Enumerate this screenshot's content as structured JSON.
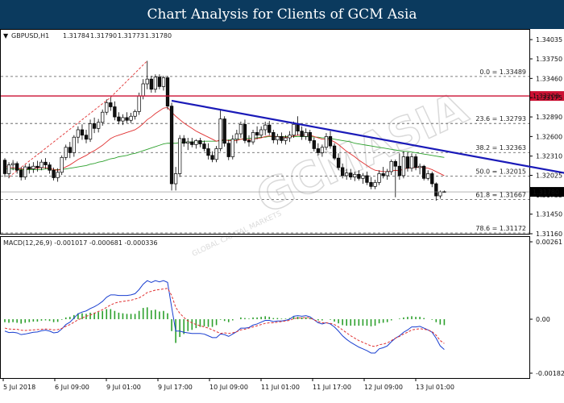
{
  "page": {
    "title": "Chart Analysis for Clients of GCM Asia"
  },
  "chart_data": {
    "type": "candlestick",
    "symbol_info": {
      "symbol": "GBPUSD,H1",
      "open": "1.31784",
      "high": "1.31790",
      "low": "1.31773",
      "close": "1.31780"
    },
    "y_axis": {
      "range": [
        1.3116,
        1.3418
      ],
      "ticks": [
        "1.34035",
        "1.33750",
        "1.33460",
        "1.33175",
        "1.32890",
        "1.32600",
        "1.32310",
        "1.32025",
        "1.31735",
        "1.31450",
        "1.31160"
      ]
    },
    "current_price": "1.31780",
    "resistance_price": "1.33200",
    "fib_levels": [
      {
        "label": "0.0 = 1.33489",
        "value": 1.33489
      },
      {
        "label": "23.6 = 1.32793",
        "value": 1.32793
      },
      {
        "label": "38.2 = 1.32363",
        "value": 1.32363
      },
      {
        "label": "50.0 = 1.32015",
        "value": 1.32015
      },
      {
        "label": "61.8 = 1.31667",
        "value": 1.31667
      },
      {
        "label": "78.6 = 1.31172",
        "value": 1.31172
      }
    ],
    "x_labels": [
      "5 Jul 2018",
      "6 Jul 09:00",
      "9 Jul 01:00",
      "9 Jul 17:00",
      "10 Jul 09:00",
      "11 Jul 01:00",
      "11 Jul 17:00",
      "12 Jul 09:00",
      "13 Jul 01:00"
    ],
    "candles": [
      [
        1.3225,
        1.3228,
        1.32,
        1.3205
      ],
      [
        1.3205,
        1.3222,
        1.3198,
        1.3218
      ],
      [
        1.3218,
        1.3225,
        1.321,
        1.322
      ],
      [
        1.322,
        1.3223,
        1.3205,
        1.321
      ],
      [
        1.321,
        1.3215,
        1.3195,
        1.32
      ],
      [
        1.32,
        1.3218,
        1.3196,
        1.3215
      ],
      [
        1.3215,
        1.322,
        1.3205,
        1.3212
      ],
      [
        1.3212,
        1.3222,
        1.3206,
        1.3216
      ],
      [
        1.3216,
        1.3224,
        1.3208,
        1.3214
      ],
      [
        1.3214,
        1.3226,
        1.321,
        1.3222
      ],
      [
        1.3222,
        1.3228,
        1.3212,
        1.3218
      ],
      [
        1.3218,
        1.3222,
        1.3205,
        1.321
      ],
      [
        1.321,
        1.3214,
        1.3195,
        1.3199
      ],
      [
        1.3199,
        1.3213,
        1.3193,
        1.3207
      ],
      [
        1.3207,
        1.3232,
        1.3203,
        1.3229
      ],
      [
        1.3229,
        1.3248,
        1.3225,
        1.3244
      ],
      [
        1.3244,
        1.3252,
        1.3228,
        1.3236
      ],
      [
        1.3236,
        1.3262,
        1.323,
        1.3259
      ],
      [
        1.3259,
        1.3275,
        1.325,
        1.327
      ],
      [
        1.327,
        1.3278,
        1.3255,
        1.3262
      ],
      [
        1.3262,
        1.327,
        1.325,
        1.3256
      ],
      [
        1.3256,
        1.3285,
        1.3252,
        1.3279
      ],
      [
        1.3279,
        1.3288,
        1.3265,
        1.3272
      ],
      [
        1.3272,
        1.3286,
        1.3266,
        1.3281
      ],
      [
        1.3281,
        1.33,
        1.3276,
        1.3296
      ],
      [
        1.3296,
        1.3315,
        1.3292,
        1.331
      ],
      [
        1.331,
        1.3318,
        1.3298,
        1.3304
      ],
      [
        1.3304,
        1.3312,
        1.3284,
        1.3289
      ],
      [
        1.3289,
        1.3296,
        1.3278,
        1.3283
      ],
      [
        1.3283,
        1.3293,
        1.3277,
        1.3288
      ],
      [
        1.3288,
        1.3296,
        1.328,
        1.3284
      ],
      [
        1.3284,
        1.3295,
        1.328,
        1.329
      ],
      [
        1.329,
        1.33,
        1.3285,
        1.3297
      ],
      [
        1.3297,
        1.3325,
        1.3292,
        1.332
      ],
      [
        1.332,
        1.3345,
        1.3315,
        1.3338
      ],
      [
        1.3338,
        1.3372,
        1.333,
        1.3345
      ],
      [
        1.3345,
        1.335,
        1.3325,
        1.333
      ],
      [
        1.333,
        1.3352,
        1.3325,
        1.3348
      ],
      [
        1.3348,
        1.3352,
        1.333,
        1.3334
      ],
      [
        1.3334,
        1.335,
        1.3328,
        1.3347
      ],
      [
        1.3347,
        1.335,
        1.33,
        1.3305
      ],
      [
        1.3305,
        1.331,
        1.318,
        1.319
      ],
      [
        1.319,
        1.3215,
        1.318,
        1.3205
      ],
      [
        1.3205,
        1.3262,
        1.32,
        1.3257
      ],
      [
        1.3257,
        1.3262,
        1.3245,
        1.325
      ],
      [
        1.325,
        1.3258,
        1.324,
        1.3252
      ],
      [
        1.3252,
        1.3258,
        1.3244,
        1.3248
      ],
      [
        1.3248,
        1.3256,
        1.3242,
        1.3254
      ],
      [
        1.3254,
        1.3258,
        1.3244,
        1.3249
      ],
      [
        1.3249,
        1.3254,
        1.3238,
        1.3242
      ],
      [
        1.3242,
        1.325,
        1.3226,
        1.3232
      ],
      [
        1.3232,
        1.3238,
        1.3222,
        1.3226
      ],
      [
        1.3226,
        1.3246,
        1.3222,
        1.3242
      ],
      [
        1.3242,
        1.3299,
        1.3238,
        1.3286
      ],
      [
        1.3286,
        1.329,
        1.3245,
        1.325
      ],
      [
        1.325,
        1.3255,
        1.3225,
        1.323
      ],
      [
        1.323,
        1.3262,
        1.3226,
        1.3256
      ],
      [
        1.3256,
        1.327,
        1.325,
        1.3264
      ],
      [
        1.3264,
        1.3282,
        1.3258,
        1.3278
      ],
      [
        1.3278,
        1.3285,
        1.325,
        1.3254
      ],
      [
        1.3254,
        1.3262,
        1.3245,
        1.3252
      ],
      [
        1.3252,
        1.327,
        1.3248,
        1.3266
      ],
      [
        1.3266,
        1.3275,
        1.3256,
        1.3262
      ],
      [
        1.3262,
        1.3275,
        1.3258,
        1.327
      ],
      [
        1.327,
        1.3282,
        1.3262,
        1.3277
      ],
      [
        1.3277,
        1.3283,
        1.3262,
        1.3266
      ],
      [
        1.3266,
        1.327,
        1.325,
        1.3255
      ],
      [
        1.3255,
        1.3264,
        1.3248,
        1.326
      ],
      [
        1.326,
        1.3266,
        1.325,
        1.3254
      ],
      [
        1.3254,
        1.3262,
        1.3248,
        1.3258
      ],
      [
        1.3258,
        1.3268,
        1.3252,
        1.3262
      ],
      [
        1.3262,
        1.3282,
        1.3258,
        1.3278
      ],
      [
        1.3278,
        1.329,
        1.3262,
        1.3268
      ],
      [
        1.3268,
        1.3275,
        1.3255,
        1.326
      ],
      [
        1.326,
        1.3272,
        1.3255,
        1.3266
      ],
      [
        1.3266,
        1.327,
        1.325,
        1.3254
      ],
      [
        1.3254,
        1.3258,
        1.3238,
        1.3242
      ],
      [
        1.3242,
        1.325,
        1.3232,
        1.3236
      ],
      [
        1.3236,
        1.3248,
        1.323,
        1.3244
      ],
      [
        1.3244,
        1.3265,
        1.324,
        1.326
      ],
      [
        1.326,
        1.3268,
        1.3242,
        1.3246
      ],
      [
        1.3246,
        1.325,
        1.3225,
        1.3228
      ],
      [
        1.3228,
        1.3235,
        1.321,
        1.3214
      ],
      [
        1.3214,
        1.322,
        1.3198,
        1.3202
      ],
      [
        1.3202,
        1.3212,
        1.3196,
        1.3206
      ],
      [
        1.3206,
        1.3212,
        1.3196,
        1.32
      ],
      [
        1.32,
        1.3208,
        1.3194,
        1.3204
      ],
      [
        1.3204,
        1.321,
        1.3195,
        1.3198
      ],
      [
        1.3198,
        1.3206,
        1.319,
        1.3202
      ],
      [
        1.3202,
        1.3208,
        1.3188,
        1.3192
      ],
      [
        1.3192,
        1.32,
        1.3182,
        1.3186
      ],
      [
        1.3186,
        1.3196,
        1.3182,
        1.3192
      ],
      [
        1.3192,
        1.321,
        1.3188,
        1.3205
      ],
      [
        1.3205,
        1.3215,
        1.3198,
        1.3202
      ],
      [
        1.3202,
        1.3212,
        1.3196,
        1.3208
      ],
      [
        1.3208,
        1.3226,
        1.3203,
        1.3223
      ],
      [
        1.3223,
        1.3226,
        1.317,
        1.3216
      ],
      [
        1.3216,
        1.3235,
        1.3196,
        1.3202
      ],
      [
        1.3202,
        1.3238,
        1.3198,
        1.323
      ],
      [
        1.323,
        1.3236,
        1.3208,
        1.3213
      ],
      [
        1.3213,
        1.3235,
        1.3208,
        1.323
      ],
      [
        1.323,
        1.3234,
        1.321,
        1.3214
      ],
      [
        1.3214,
        1.322,
        1.3204,
        1.3216
      ],
      [
        1.3216,
        1.3218,
        1.3195,
        1.3198
      ],
      [
        1.3198,
        1.321,
        1.3195,
        1.3205
      ],
      [
        1.3205,
        1.3208,
        1.3185,
        1.319
      ],
      [
        1.319,
        1.3192,
        1.3165,
        1.3172
      ],
      [
        1.3172,
        1.318,
        1.3168,
        1.3178
      ],
      [
        1.31784,
        1.318,
        1.31773,
        1.3178
      ]
    ],
    "ma_red": [
      1.3216,
      1.3214,
      1.3214,
      1.3213,
      1.3212,
      1.3212,
      1.3212,
      1.3213,
      1.3213,
      1.3214,
      1.3214,
      1.3213,
      1.3211,
      1.321,
      1.3212,
      1.3215,
      1.3218,
      1.3222,
      1.3226,
      1.3229,
      1.3232,
      1.3236,
      1.3239,
      1.3243,
      1.3247,
      1.3252,
      1.3257,
      1.326,
      1.3262,
      1.3264,
      1.3266,
      1.3268,
      1.327,
      1.3274,
      1.3279,
      1.3285,
      1.3289,
      1.3294,
      1.3298,
      1.3302,
      1.3303,
      1.3296,
      1.329,
      1.3285,
      1.328,
      1.3276,
      1.3272,
      1.3268,
      1.3265,
      1.3262,
      1.3259,
      1.3256,
      1.3253,
      1.3255,
      1.3255,
      1.3254,
      1.3254,
      1.3254,
      1.3256,
      1.3256,
      1.3255,
      1.3256,
      1.3257,
      1.3258,
      1.326,
      1.3261,
      1.326,
      1.326,
      1.3259,
      1.3259,
      1.3259,
      1.3261,
      1.3262,
      1.3262,
      1.3262,
      1.3262,
      1.326,
      1.3258,
      1.3256,
      1.3256,
      1.3255,
      1.3252,
      1.3248,
      1.3243,
      1.3238,
      1.3234,
      1.323,
      1.3225,
      1.3221,
      1.3217,
      1.3213,
      1.321,
      1.3209,
      1.3208,
      1.3208,
      1.3209,
      1.321,
      1.3209,
      1.3212,
      1.3213,
      1.3214,
      1.3214,
      1.3215,
      1.3214,
      1.3213,
      1.3211,
      1.3208,
      1.3205,
      1.3202
    ],
    "ma_green": [
      1.3212,
      1.3212,
      1.3212,
      1.3211,
      1.3211,
      1.3211,
      1.3211,
      1.3211,
      1.3211,
      1.3211,
      1.3212,
      1.3212,
      1.3211,
      1.3211,
      1.3211,
      1.3212,
      1.3213,
      1.3214,
      1.3215,
      1.3216,
      1.3217,
      1.3219,
      1.322,
      1.3222,
      1.3223,
      1.3225,
      1.3227,
      1.3228,
      1.323,
      1.3231,
      1.3232,
      1.3234,
      1.3235,
      1.3237,
      1.3239,
      1.3241,
      1.3243,
      1.3245,
      1.3247,
      1.3249,
      1.325,
      1.325,
      1.325,
      1.3251,
      1.3251,
      1.3252,
      1.3252,
      1.3252,
      1.3252,
      1.3253,
      1.3253,
      1.3253,
      1.3253,
      1.3254,
      1.3254,
      1.3255,
      1.3255,
      1.3256,
      1.3256,
      1.3257,
      1.3257,
      1.3258,
      1.3258,
      1.3259,
      1.3259,
      1.326,
      1.326,
      1.326,
      1.326,
      1.326,
      1.326,
      1.326,
      1.326,
      1.326,
      1.326,
      1.326,
      1.3259,
      1.3259,
      1.3258,
      1.3258,
      1.3257,
      1.3256,
      1.3255,
      1.3254,
      1.3253,
      1.3252,
      1.325,
      1.3249,
      1.3248,
      1.3247,
      1.3246,
      1.3245,
      1.3244,
      1.3243,
      1.3242,
      1.3241,
      1.324,
      1.3239,
      1.3238,
      1.3238,
      1.3237,
      1.3236,
      1.3235,
      1.3234,
      1.3233,
      1.3232,
      1.3231,
      1.323,
      1.3229
    ],
    "trendline": {
      "from": {
        "index": 41,
        "value": 1.3313
      },
      "to": {
        "index": 142,
        "value": 1.3201
      }
    },
    "macd": {
      "label": "MACD(12,26,9) -0.001017 -0.000681 -0.000336",
      "range": [
        -0.00182,
        0.00261
      ],
      "ticks": [
        "0.00261",
        "0.00",
        "-0.00182"
      ],
      "histogram": [
        -0.0001,
        -0.00012,
        -0.0001,
        -0.00012,
        -0.00015,
        -0.00012,
        -0.0001,
        -8e-05,
        -8e-05,
        -5e-05,
        -4e-05,
        -6e-05,
        -0.0001,
        -9e-05,
        -2e-05,
        6e-05,
        8e-05,
        0.00014,
        0.0002,
        0.0002,
        0.00018,
        0.00022,
        0.00022,
        0.00024,
        0.00028,
        0.00034,
        0.00034,
        0.00028,
        0.00022,
        0.0002,
        0.00018,
        0.00018,
        0.00018,
        0.00028,
        0.00038,
        0.0004,
        0.0003,
        0.00032,
        0.00026,
        0.00028,
        0.0002,
        -0.0004,
        -0.0008,
        -0.0006,
        -0.0005,
        -0.0004,
        -0.00036,
        -0.0003,
        -0.00026,
        -0.00024,
        -0.00026,
        -0.00026,
        -0.0002,
        -2e-05,
        -6e-05,
        -0.0001,
        -4e-05,
        0.0,
        6e-05,
        4e-05,
        2e-05,
        6e-05,
        6e-05,
        8e-05,
        0.0001,
        8e-05,
        4e-05,
        4e-05,
        2e-05,
        2e-05,
        4e-05,
        8e-05,
        8e-05,
        6e-05,
        6e-05,
        4e-05,
        0.0,
        -4e-05,
        -4e-05,
        0.0,
        -2e-05,
        -8e-05,
        -0.00014,
        -0.0002,
        -0.00022,
        -0.00022,
        -0.00022,
        -0.00022,
        -0.00022,
        -0.00022,
        -0.00024,
        -0.00022,
        -0.00014,
        -0.00012,
        -0.0001,
        -4e-05,
        0.0,
        2e-05,
        6e-05,
        8e-05,
        0.0001,
        8e-05,
        8e-05,
        4e-05,
        0.0,
        -2e-05,
        -0.0001,
        -0.00018,
        -0.0002
      ],
      "macd_line": [
        -0.0004,
        -0.00045,
        -0.00044,
        -0.00046,
        -0.00052,
        -0.0005,
        -0.00047,
        -0.00044,
        -0.00043,
        -0.00039,
        -0.00037,
        -0.0004,
        -0.00046,
        -0.00044,
        -0.00033,
        -0.00018,
        -0.0001,
        4e-05,
        0.00018,
        0.00024,
        0.00028,
        0.00036,
        0.00042,
        0.0005,
        0.0006,
        0.00074,
        0.00082,
        0.00082,
        0.0008,
        0.0008,
        0.0008,
        0.00082,
        0.00086,
        0.001,
        0.00118,
        0.0013,
        0.00124,
        0.0013,
        0.00126,
        0.0013,
        0.00124,
        0.0004,
        -0.0004,
        -0.0004,
        -0.00044,
        -0.00046,
        -0.00048,
        -0.00048,
        -0.00048,
        -0.0005,
        -0.00056,
        -0.00062,
        -0.00062,
        -0.0005,
        -0.00052,
        -0.00058,
        -0.0005,
        -0.00042,
        -0.0003,
        -0.0003,
        -0.00028,
        -0.0002,
        -0.00016,
        -0.0001,
        -4e-05,
        -4e-05,
        -8e-05,
        -6e-05,
        -6e-05,
        -4e-05,
        0.0,
        0.0001,
        0.00012,
        0.0001,
        0.00012,
        8e-05,
        -2e-05,
        -0.00012,
        -0.00016,
        -0.00012,
        -0.00016,
        -0.00026,
        -0.0004,
        -0.00056,
        -0.00068,
        -0.00078,
        -0.00086,
        -0.00094,
        -0.001,
        -0.00106,
        -0.00114,
        -0.00114,
        -0.001,
        -0.00096,
        -0.0009,
        -0.00076,
        -0.00064,
        -0.00056,
        -0.00044,
        -0.00036,
        -0.00026,
        -0.00026,
        -0.00024,
        -0.0003,
        -0.00036,
        -0.00044,
        -0.00064,
        -0.0009,
        -0.00102
      ],
      "signal_line": [
        -0.0003,
        -0.00033,
        -0.00034,
        -0.00034,
        -0.00037,
        -0.00038,
        -0.00037,
        -0.00036,
        -0.00035,
        -0.00034,
        -0.00033,
        -0.00034,
        -0.00036,
        -0.00035,
        -0.00031,
        -0.00024,
        -0.00018,
        -0.0001,
        -2e-05,
        4e-05,
        0.0001,
        0.00014,
        0.0002,
        0.00026,
        0.00032,
        0.0004,
        0.00048,
        0.00054,
        0.00058,
        0.0006,
        0.00062,
        0.00064,
        0.00068,
        0.00072,
        0.0008,
        0.0009,
        0.00094,
        0.00098,
        0.001,
        0.00102,
        0.00104,
        0.0008,
        0.0004,
        0.0002,
        6e-05,
        -6e-05,
        -0.00012,
        -0.00018,
        -0.00022,
        -0.00026,
        -0.0003,
        -0.00036,
        -0.00042,
        -0.00048,
        -0.00046,
        -0.00048,
        -0.00046,
        -0.00042,
        -0.00036,
        -0.00034,
        -0.0003,
        -0.00026,
        -0.00022,
        -0.00018,
        -0.00014,
        -0.00012,
        -0.00012,
        -0.0001,
        -8e-05,
        -6e-05,
        -4e-05,
        2e-05,
        4e-05,
        4e-05,
        6e-05,
        4e-05,
        -2e-05,
        -8e-05,
        -0.00012,
        -0.00012,
        -0.00014,
        -0.00018,
        -0.00026,
        -0.00036,
        -0.00046,
        -0.00056,
        -0.00064,
        -0.00072,
        -0.00078,
        -0.00084,
        -0.0009,
        -0.00092,
        -0.00086,
        -0.00084,
        -0.0008,
        -0.00072,
        -0.00064,
        -0.00058,
        -0.0005,
        -0.00044,
        -0.00036,
        -0.00034,
        -0.00032,
        -0.00034,
        -0.00036,
        -0.00042,
        -0.00054,
        -0.00072,
        -0.00082
      ]
    },
    "colors": {
      "bull": "#ffffff",
      "bear": "#111111",
      "ma_red": "#e03030",
      "ma_green": "#2ca02c",
      "trendline": "#1a1ab8",
      "resistance": "#cc1133",
      "fib": "#555555",
      "zigzag": "#e03030",
      "macd_line": "#1a3fd0",
      "signal_line": "#e03030",
      "histogram": "#2ca02c"
    }
  },
  "watermark": {
    "text": "GCMASIA",
    "subtext": "GLOBAL CAPITAL MARKETS"
  }
}
